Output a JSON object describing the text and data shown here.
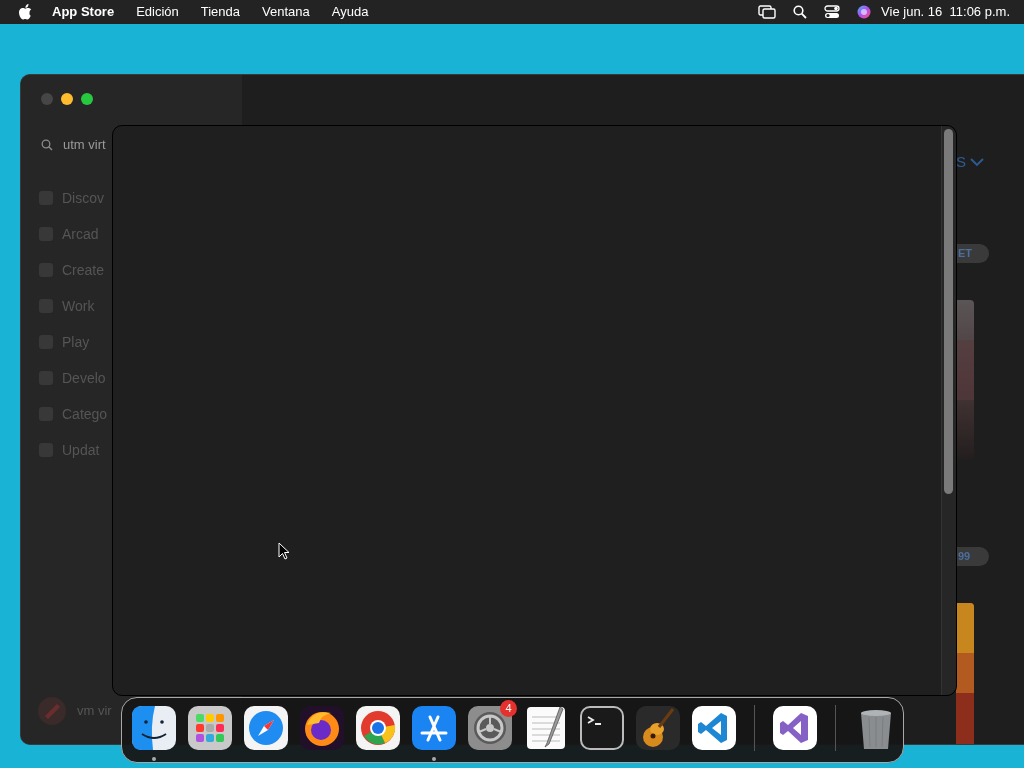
{
  "menu_bar": {
    "app_name": "App Store",
    "menus": [
      "Edición",
      "Tienda",
      "Ventana",
      "Ayuda"
    ],
    "clock": "Vie jun. 16  11:06 p.m."
  },
  "window": {
    "traffic_lights": [
      {
        "kind": "close",
        "enabled": false
      },
      {
        "kind": "minimize",
        "enabled": true
      },
      {
        "kind": "zoom",
        "enabled": true
      }
    ],
    "search": {
      "value": "utm virt"
    },
    "sidebar": {
      "items": [
        {
          "label": "Discov"
        },
        {
          "label": "Arcad"
        },
        {
          "label": "Create"
        },
        {
          "label": "Work"
        },
        {
          "label": "Play"
        },
        {
          "label": "Develo"
        },
        {
          "label": "Catego"
        },
        {
          "label": "Updat"
        }
      ]
    },
    "account": {
      "name": "vm vir"
    },
    "content": {
      "link": "S",
      "buttons": [
        "ET",
        "99"
      ]
    }
  },
  "dock": {
    "apps": [
      {
        "kind": "finder",
        "running": true
      },
      {
        "kind": "launchpad",
        "running": false
      },
      {
        "kind": "safari",
        "running": false
      },
      {
        "kind": "firefox",
        "running": false
      },
      {
        "kind": "chrome",
        "running": false
      },
      {
        "kind": "appstore",
        "running": true
      },
      {
        "kind": "settings",
        "running": false,
        "badge": "4"
      },
      {
        "kind": "textedit",
        "running": false
      },
      {
        "kind": "terminal",
        "running": false
      },
      {
        "kind": "garageband",
        "running": false
      },
      {
        "kind": "vscode",
        "running": false
      },
      {
        "kind": "separator"
      },
      {
        "kind": "visualstudio",
        "running": false
      },
      {
        "kind": "separator"
      },
      {
        "kind": "trash",
        "running": false
      }
    ]
  }
}
